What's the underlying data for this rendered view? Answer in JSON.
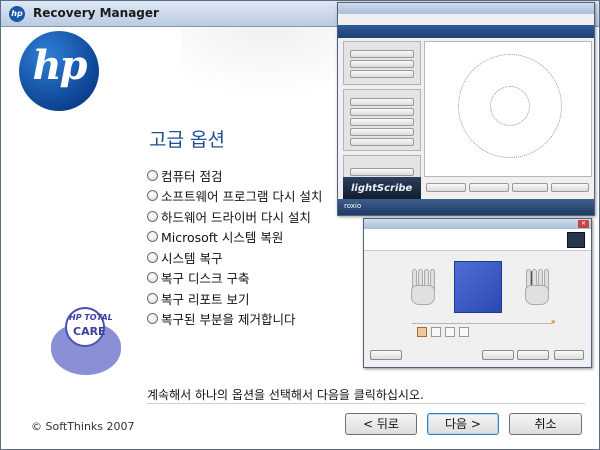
{
  "window": {
    "title": "Recovery Manager"
  },
  "brand": {
    "hp_logo_text": "hp",
    "care_logo_line1": "HP TOTAL",
    "care_logo_line2": "CARE"
  },
  "main": {
    "heading": "고급 옵션",
    "options": [
      "컴퓨터 점검",
      "소프트웨어 프로그램 다시 설치",
      "하드웨어 드라이버 다시 설치",
      "Microsoft 시스템 복원",
      "시스템 복구",
      "복구 디스크 구축",
      "복구 리포트 보기",
      "복구된 부분을 제거합니다"
    ],
    "hint": "계속해서 하나의 옵션을 선택해서 다음을 클릭하십시오.",
    "copyright": "© SoftThinks 2007"
  },
  "buttons": {
    "back": "< 뒤로",
    "next": "다음 >",
    "cancel": "취소"
  },
  "roxio": {
    "footer_logo": "roxio",
    "lightscribe": "lightScribe"
  },
  "colors": {
    "accent": "#1e4d96",
    "brand_blue": "#0b3f8f"
  }
}
